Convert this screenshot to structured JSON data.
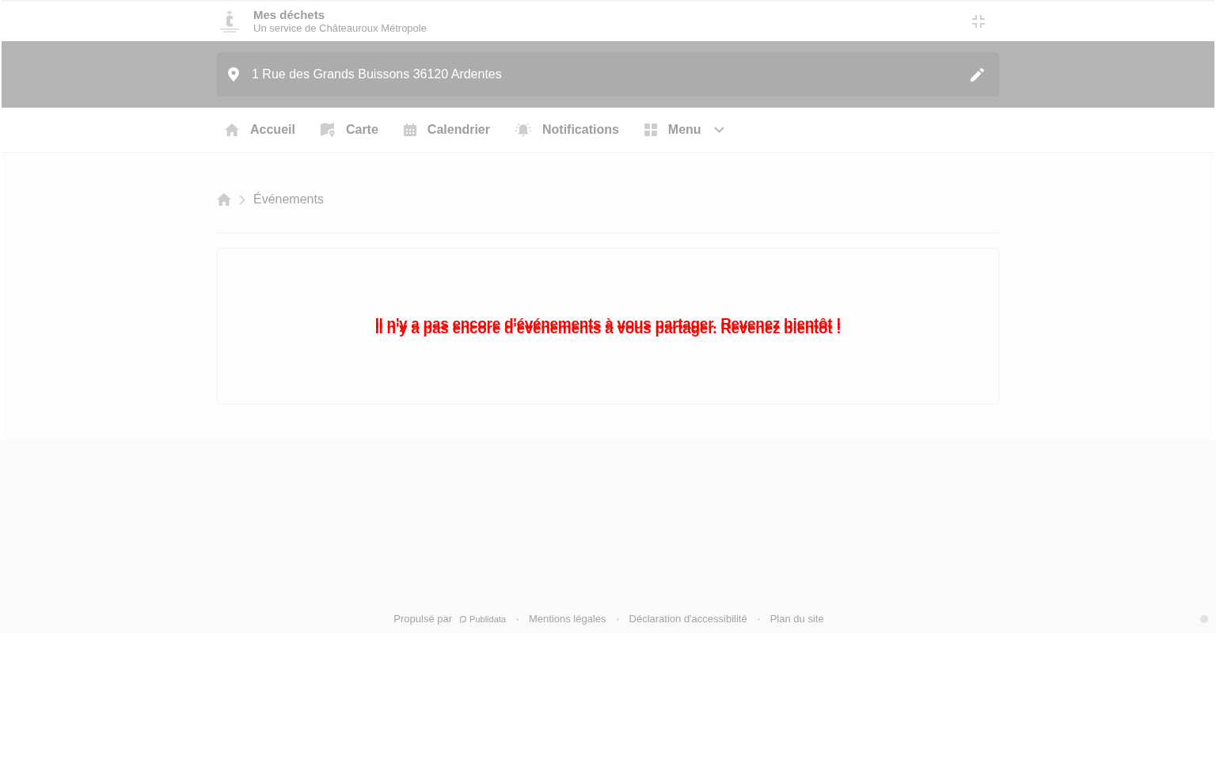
{
  "header": {
    "title": "Mes déchets",
    "subtitle": "Un service de Châteauroux Métropole"
  },
  "address": {
    "value": "1 Rue des Grands Buissons 36120 Ardentes"
  },
  "nav": [
    {
      "label": "Accueil",
      "kind": "link"
    },
    {
      "label": "Carte",
      "kind": "link"
    },
    {
      "label": "Calendrier",
      "kind": "link"
    },
    {
      "label": "Notifications",
      "kind": "link"
    },
    {
      "label": "Menu",
      "kind": "dropdown"
    }
  ],
  "breadcrumb": {
    "current": "Événements"
  },
  "empty_message": "Il n'y a pas encore d'événements à vous partager. Revenez bientôt !",
  "footer": {
    "powered_by": "Propulsé par",
    "brand": "Publidata",
    "links": [
      "Mentions légales",
      "Déclaration d'accessibilité",
      "Plan du site"
    ]
  }
}
